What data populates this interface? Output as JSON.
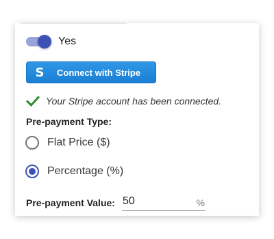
{
  "toggle": {
    "label": "Yes",
    "on": true
  },
  "stripe_button": {
    "icon_letter": "S",
    "label": "Connect with Stripe"
  },
  "connected_message": "Your Stripe account has been connected.",
  "prepayment_type": {
    "label": "Pre-payment Type:",
    "options": [
      {
        "label": "Flat Price ($)",
        "selected": false
      },
      {
        "label": "Percentage (%)",
        "selected": true
      }
    ]
  },
  "prepayment_value": {
    "label": "Pre-payment Value:",
    "value": "50",
    "suffix": "%"
  },
  "colors": {
    "accent": "#3f51b5",
    "stripe_blue": "#1a7fd4",
    "check_green": "#2e8b2e"
  }
}
